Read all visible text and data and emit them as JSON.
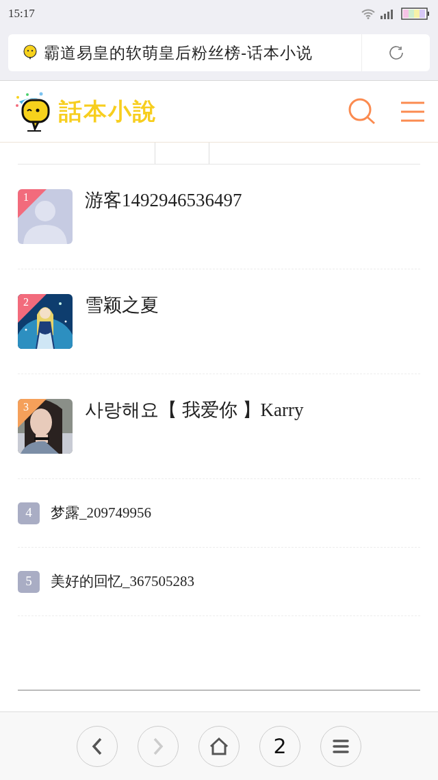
{
  "status_bar": {
    "time": "15:17"
  },
  "address_bar": {
    "title": "霸道易皇的软萌皇后粉丝榜-话本小说"
  },
  "site_header": {
    "logo_text": "話本小說"
  },
  "fans": [
    {
      "kind": "top",
      "rank": "1",
      "color": "#f26b7c",
      "name": "游客1492946536497",
      "avatar": {
        "kind": "default"
      }
    },
    {
      "kind": "top",
      "rank": "2",
      "color": "#f26b7c",
      "name": "雪颖之夏"
    },
    {
      "kind": "top",
      "rank": "3",
      "color": "#f5a05a",
      "name": "사랑해요【 我爱你 】Karry"
    },
    {
      "kind": "plain",
      "rank": "4",
      "color": "#a9adc4",
      "name": "梦露_209749956"
    },
    {
      "kind": "plain",
      "rank": "5",
      "color": "#a9adc4",
      "name": "美好的回忆_367505283"
    }
  ],
  "toolbar": [
    {
      "kind": "back",
      "disabled": false
    },
    {
      "kind": "forward",
      "disabled": true
    },
    {
      "kind": "home",
      "disabled": false
    },
    {
      "kind": "tabs",
      "label": "2",
      "disabled": false
    },
    {
      "kind": "menu",
      "disabled": false
    }
  ]
}
